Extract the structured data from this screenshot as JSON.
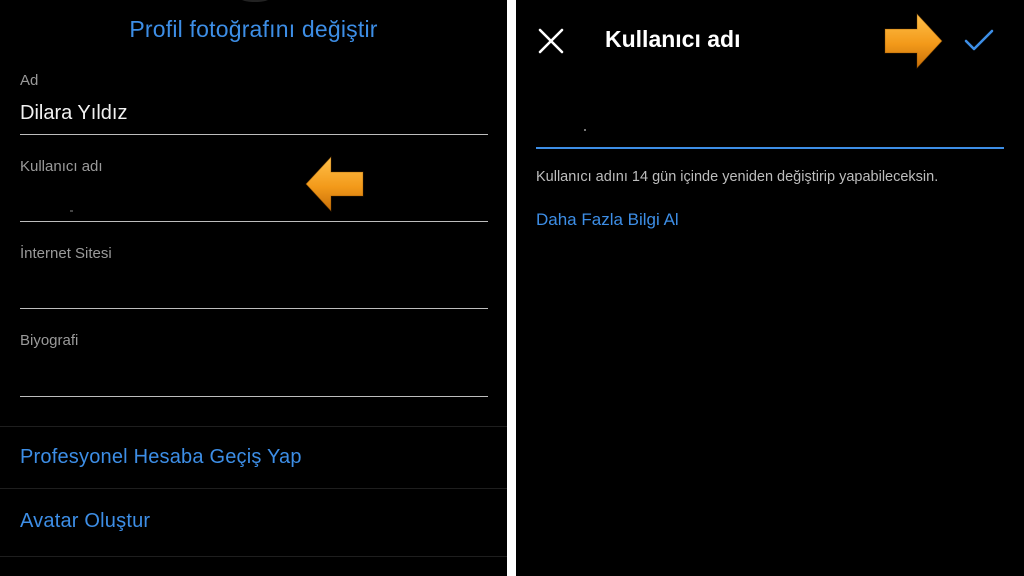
{
  "edit_profile": {
    "change_photo_label": "Profil fotoğrafını değiştir",
    "fields": {
      "name": {
        "label": "Ad",
        "value": "Dilara Yıldız"
      },
      "username": {
        "label": "Kullanıcı adı",
        "value": ""
      },
      "website": {
        "label": "İnternet Sitesi",
        "value": ""
      },
      "bio": {
        "label": "Biyografi",
        "value": ""
      }
    },
    "menu": {
      "professional": "Profesyonel Hesaba Geçiş Yap",
      "avatar": "Avatar Oluştur"
    }
  },
  "username_screen": {
    "title": "Kullanıcı adı",
    "input_value": "",
    "info_text": "Kullanıcı adını 14 gün içinde yeniden değiştirip yapabileceksin.",
    "learn_more": "Daha Fazla Bilgi Al"
  },
  "colors": {
    "background": "#000000",
    "accent_blue": "#3d8ee6",
    "arrow_orange": "#f0a020",
    "separator_white": "#ffffff"
  },
  "icons": {
    "close": "close-icon",
    "confirm": "checkmark-icon",
    "annotation_left": "arrow-left-icon",
    "annotation_right": "arrow-right-icon"
  }
}
